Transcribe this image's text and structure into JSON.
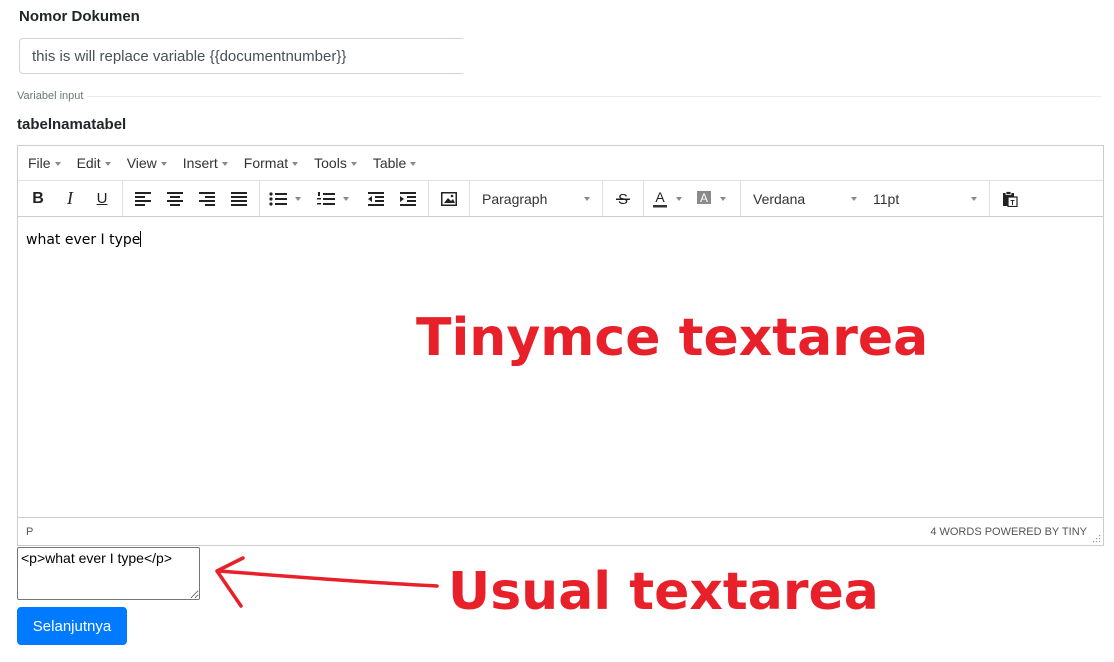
{
  "form": {
    "document_number_label": "Nomor Dokumen",
    "document_number_value": "this is will replace variable {{documentnumber}}",
    "variable_input_label": "Variabel input",
    "table_name_label": "tabelnamatabel"
  },
  "editor": {
    "menus": [
      "File",
      "Edit",
      "View",
      "Insert",
      "Format",
      "Tools",
      "Table"
    ],
    "block_format": "Paragraph",
    "font_family": "Verdana",
    "font_size": "11pt",
    "content_text": "what ever I type",
    "status_path": "P",
    "status_right": "4 WORDS POWERED BY TINY",
    "text_color": "#333333",
    "highlight_color": "#8a8a8a"
  },
  "plain_textarea": {
    "value": "<p>what ever I type</p>"
  },
  "next_button": {
    "label": "Selanjutnya"
  },
  "annotations": {
    "tinymce_label": "Tinymce textarea",
    "usual_label": "Usual textarea",
    "color": "#e8202a"
  }
}
